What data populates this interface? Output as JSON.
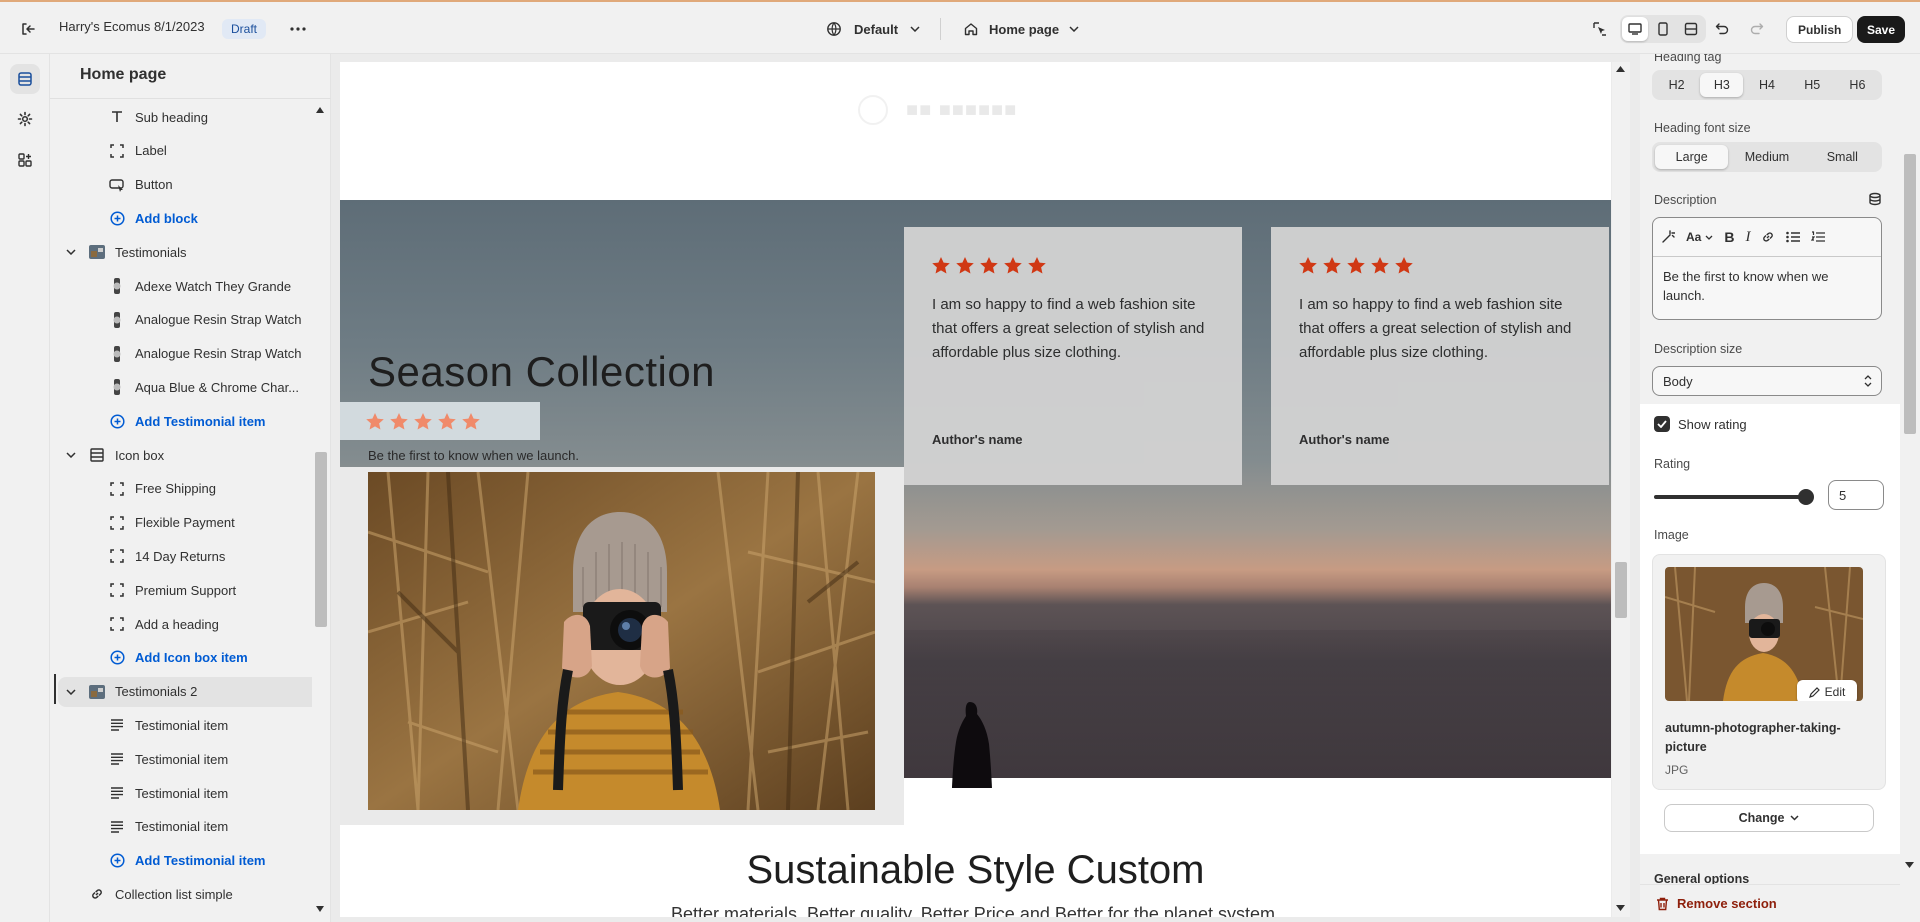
{
  "topbar": {
    "store_name": "Harry's Ecomus 8/1/2023",
    "status_badge": "Draft",
    "theme_label": "Default",
    "page_label": "Home page",
    "publish_label": "Publish",
    "save_label": "Save"
  },
  "sidebar": {
    "title": "Home page",
    "rows": [
      {
        "label": "Sub heading",
        "icon": "text-icon",
        "kind": "child"
      },
      {
        "label": "Label",
        "icon": "block-icon",
        "kind": "child"
      },
      {
        "label": "Button",
        "icon": "button-icon",
        "kind": "child"
      },
      {
        "label": "Add block",
        "icon": "plus-circle-icon",
        "kind": "add"
      },
      {
        "label": "Testimonials",
        "icon": "image-thumb-icon",
        "kind": "section"
      },
      {
        "label": "Adexe Watch They Grande",
        "icon": "product-thumb-icon",
        "kind": "child"
      },
      {
        "label": "Analogue Resin Strap Watch",
        "icon": "product-thumb-icon",
        "kind": "child"
      },
      {
        "label": "Analogue Resin Strap Watch",
        "icon": "product-thumb-icon",
        "kind": "child"
      },
      {
        "label": "Aqua Blue & Chrome Char...",
        "icon": "product-thumb-icon",
        "kind": "child"
      },
      {
        "label": "Add Testimonial item",
        "icon": "plus-circle-icon",
        "kind": "add"
      },
      {
        "label": "Icon box",
        "icon": "layout-icon",
        "kind": "section"
      },
      {
        "label": "Free Shipping",
        "icon": "block-icon",
        "kind": "child"
      },
      {
        "label": "Flexible Payment",
        "icon": "block-icon",
        "kind": "child"
      },
      {
        "label": "14 Day Returns",
        "icon": "block-icon",
        "kind": "child"
      },
      {
        "label": "Premium Support",
        "icon": "block-icon",
        "kind": "child"
      },
      {
        "label": "Add a heading",
        "icon": "block-icon",
        "kind": "child"
      },
      {
        "label": "Add Icon box item",
        "icon": "plus-circle-icon",
        "kind": "add"
      },
      {
        "label": "Testimonials 2",
        "icon": "image-thumb-icon",
        "kind": "section-selected"
      },
      {
        "label": "Testimonial item",
        "icon": "lines-icon",
        "kind": "child"
      },
      {
        "label": "Testimonial item",
        "icon": "lines-icon",
        "kind": "child"
      },
      {
        "label": "Testimonial item",
        "icon": "lines-icon",
        "kind": "child"
      },
      {
        "label": "Testimonial item",
        "icon": "lines-icon",
        "kind": "child"
      },
      {
        "label": "Add Testimonial item",
        "icon": "plus-circle-icon",
        "kind": "add"
      },
      {
        "label": "Collection list simple",
        "icon": "link-icon",
        "kind": "section-nochev"
      }
    ]
  },
  "preview": {
    "hero_title": "Season Collection",
    "hero_description": "Be the first to know when we launch.",
    "hero_rating": 5,
    "cards": [
      {
        "rating": 5,
        "quote": "I am so happy to find a web fashion site that offers a great selection of stylish and affordable plus size clothing.",
        "author": "Author's name"
      },
      {
        "rating": 5,
        "quote": "I am so happy to find a web fashion site that offers a great selection of stylish and affordable plus size clothing.",
        "author": "Author's name"
      }
    ],
    "next_title": "Sustainable Style Custom",
    "next_subtitle": "Better materials, Better quality, Better Price and Better for the planet system."
  },
  "settings": {
    "heading_tag_label": "Heading tag",
    "heading_tags": [
      "H2",
      "H3",
      "H4",
      "H5",
      "H6"
    ],
    "heading_tag_selected": "H3",
    "heading_size_label": "Heading font size",
    "heading_sizes": [
      "Large",
      "Medium",
      "Small"
    ],
    "heading_size_selected": "Large",
    "description_label": "Description",
    "description_text": "Be the first to know when we launch.",
    "description_size_label": "Description size",
    "description_size_value": "Body",
    "show_rating_label": "Show rating",
    "show_rating_checked": true,
    "rating_label": "Rating",
    "rating_value": "5",
    "rating_fraction": 1.0,
    "image_label": "Image",
    "edit_label": "Edit",
    "image_filename": "autumn-photographer-taking-picture",
    "image_type": "JPG",
    "change_label": "Change",
    "next_group_label": "General options",
    "remove_label": "Remove section"
  },
  "colors": {
    "star_preview": "#d6350f",
    "star_hero": "#f08a6a",
    "link_blue": "#005bd3",
    "danger": "#8e1f0b"
  }
}
